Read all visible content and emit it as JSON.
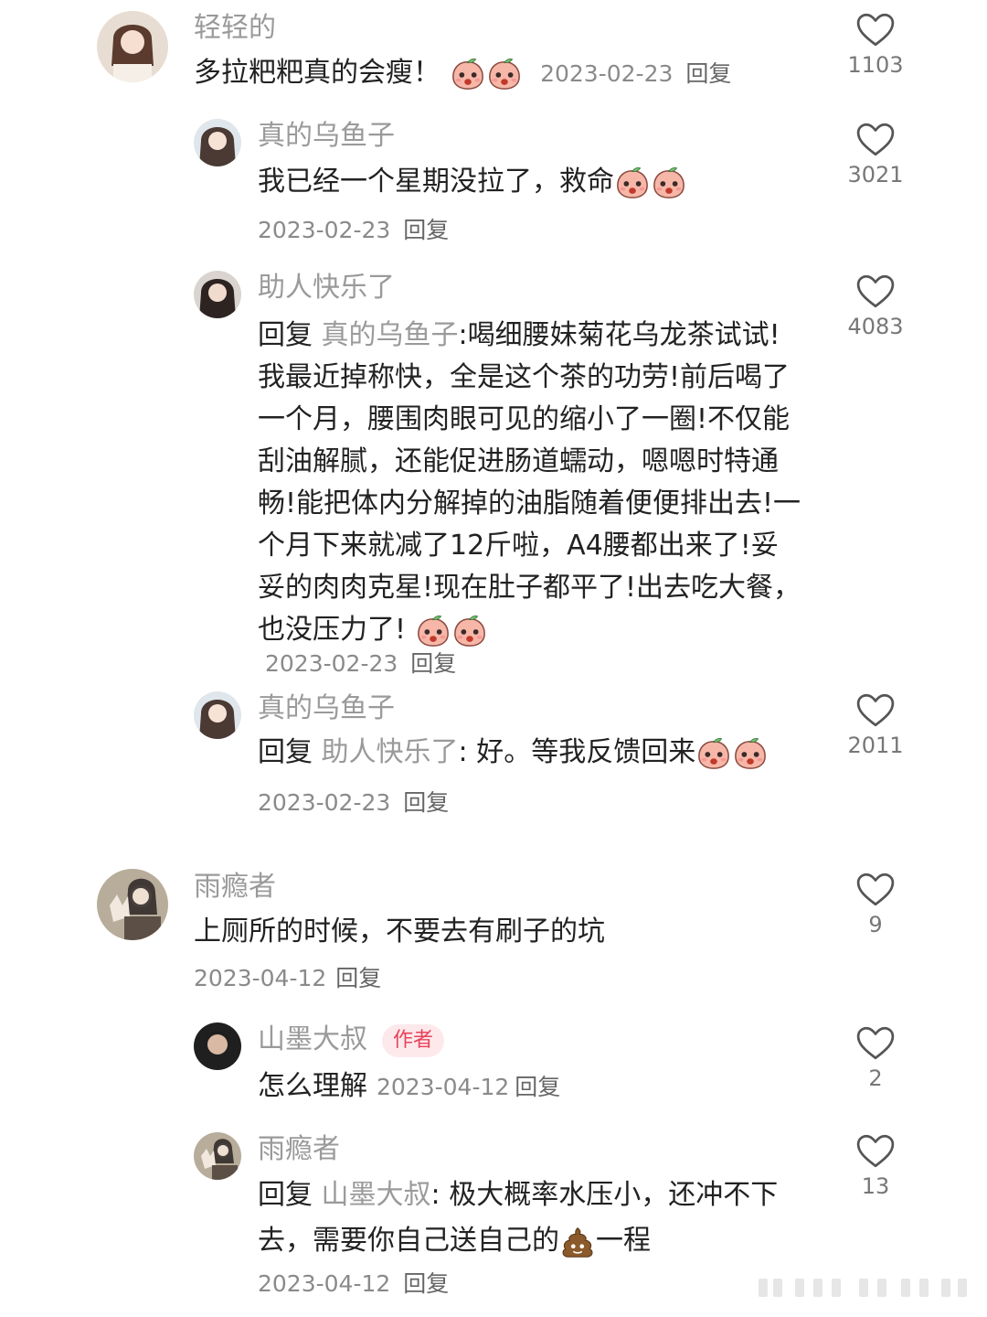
{
  "reply_label": "回复",
  "comments": [
    {
      "user": "轻轻的",
      "text": "多拉粑粑真的会瘦！",
      "emoji": [
        "shocked-peach-emoji",
        "shocked-peach-emoji"
      ],
      "date": "2023-02-23",
      "likes": "1103"
    },
    {
      "user": "真的乌鱼子",
      "text": "我已经一个星期没拉了，救命",
      "emoji": [
        "crying-peach-emoji",
        "crying-peach-emoji"
      ],
      "date": "2023-02-23",
      "likes": "3021"
    },
    {
      "user": "助人快乐了",
      "reply_prefix": "回复",
      "reply_to": "真的乌鱼子",
      "text": ":喝细腰妹菊花乌龙茶试试!我最近掉称快，全是这个茶的功劳!前后喝了一个月，腰围肉眼可见的缩小了一圈!不仅能刮油解腻，还能促进肠道蠕动，嗯嗯时特通畅!能把体内分解掉的油脂随着便便排出去!一个月下来就减了12斤啦，A4腰都出来了!妥妥的肉肉克星!现在肚子都平了!出去吃大餐，也没压力了!",
      "emoji": [
        "pleading-peach-emoji",
        "pleading-peach-emoji"
      ],
      "date": "2023-02-23",
      "likes": "4083"
    },
    {
      "user": "真的乌鱼子",
      "reply_prefix": "回复",
      "reply_to": "助人快乐了",
      "text": ": 好。等我反馈回来",
      "emoji": [
        "tearful-peach-emoji",
        "tearful-peach-emoji"
      ],
      "date": "2023-02-23",
      "likes": "2011"
    },
    {
      "user": "雨瘾者",
      "text": "上厕所的时候，不要去有刷子的坑",
      "date": "2023-04-12",
      "likes": "9"
    },
    {
      "user": "山墨大叔",
      "badge": "作者",
      "text": "怎么理解",
      "date": "2023-04-12",
      "likes": "2"
    },
    {
      "user": "雨瘾者",
      "reply_prefix": "回复",
      "reply_to": "山墨大叔",
      "text": ": 极大概率水压小，还冲不下去，需要你自己送自己的",
      "emoji": [
        "poop-emoji"
      ],
      "text_after": "一程",
      "date": "2023-04-12",
      "likes": "13"
    }
  ]
}
